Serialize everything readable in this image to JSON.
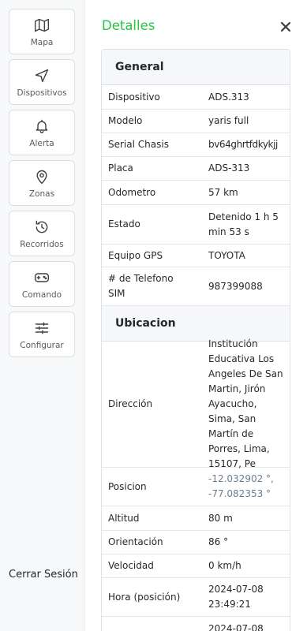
{
  "sidebar": {
    "items": [
      {
        "label": "Mapa",
        "icon": "map-icon"
      },
      {
        "label": "Dispositivos",
        "icon": "navigation-arrow-icon"
      },
      {
        "label": "Alerta",
        "icon": "bell-icon"
      },
      {
        "label": "Zonas",
        "icon": "map-pin-icon"
      },
      {
        "label": "Recorridos",
        "icon": "history-icon"
      },
      {
        "label": "Comando",
        "icon": "gamepad-icon"
      },
      {
        "label": "Configurar",
        "icon": "sliders-icon"
      }
    ],
    "logout_label": "Cerrar Sesión"
  },
  "panel": {
    "title": "Detalles",
    "close_icon": "close-icon",
    "accent_color": "#28c445"
  },
  "general": {
    "heading": "General",
    "rows": [
      {
        "key": "Dispositivo",
        "value": "ADS.313"
      },
      {
        "key": "Modelo",
        "value": "yaris full"
      },
      {
        "key": "Serial Chasis",
        "value": "bv64ghrtfdkykjj"
      },
      {
        "key": "Placa",
        "value": "ADS-313"
      },
      {
        "key": "Odometro",
        "value": "57 km"
      },
      {
        "key": "Estado",
        "value": "Detenido 1 h 5 min 53 s"
      },
      {
        "key": "Equipo GPS",
        "value": "TOYOTA"
      },
      {
        "key": "# de Telefono SIM",
        "value": "987399088"
      }
    ]
  },
  "ubicacion": {
    "heading": "Ubicacion",
    "rows": [
      {
        "key": "Dirección",
        "value": "Institución Educativa Los Angeles De San Martin, Jirón Ayacucho, Sima, San Martín de Porres, Lima, 15107, Pe"
      },
      {
        "key": "Posicion",
        "value": "-12.032902 °, -77.082353 °"
      },
      {
        "key": "Altitud",
        "value": "80 m"
      },
      {
        "key": "Orientación",
        "value": "86 °"
      },
      {
        "key": "Velocidad",
        "value": "0 km/h"
      },
      {
        "key": "Hora (posición)",
        "value": "2024-07-08 23:49:21"
      },
      {
        "key": "",
        "value": "2024-07-08"
      }
    ]
  }
}
